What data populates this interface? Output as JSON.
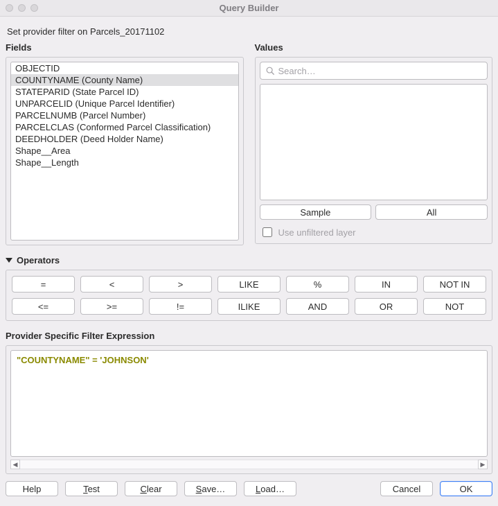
{
  "window": {
    "title": "Query Builder",
    "subtitle": "Set provider filter on Parcels_20171102"
  },
  "fields": {
    "label": "Fields",
    "items": [
      "OBJECTID",
      "COUNTYNAME (County Name)",
      "STATEPARID (State Parcel ID)",
      "UNPARCELID (Unique Parcel Identifier)",
      "PARCELNUMB (Parcel Number)",
      "PARCELCLAS (Conformed Parcel Classification)",
      "DEEDHOLDER (Deed Holder Name)",
      "Shape__Area",
      "Shape__Length"
    ],
    "selected_index": 1
  },
  "values": {
    "label": "Values",
    "search_placeholder": "Search…",
    "sample_label": "Sample",
    "all_label": "All",
    "use_unfiltered_label": "Use unfiltered layer",
    "use_unfiltered_checked": false
  },
  "operators": {
    "label": "Operators",
    "row1": [
      "=",
      "<",
      ">",
      "LIKE",
      "%",
      "IN",
      "NOT IN"
    ],
    "row2": [
      "<=",
      ">=",
      "!=",
      "ILIKE",
      "AND",
      "OR",
      "NOT"
    ]
  },
  "expression": {
    "label": "Provider Specific Filter Expression",
    "text": "\"COUNTYNAME\" = 'JOHNSON'"
  },
  "footer": {
    "help": "Help",
    "test": "Test",
    "clear": "Clear",
    "save": "Save…",
    "load": "Load…",
    "cancel": "Cancel",
    "ok": "OK"
  }
}
